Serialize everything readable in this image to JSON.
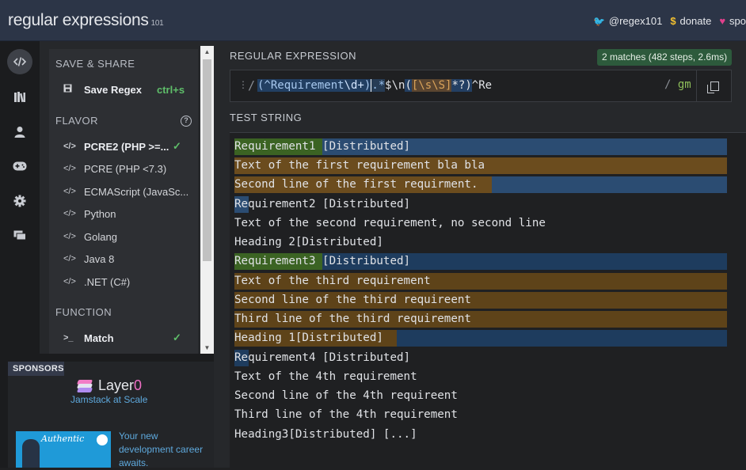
{
  "header": {
    "brand": "regular expressions",
    "brand_sup": "101",
    "twitter": "@regex101",
    "donate": "donate",
    "sponsor": "spo"
  },
  "left_nav": {
    "icons": [
      "regex-editor-icon",
      "library-icon",
      "user-icon",
      "quiz-icon",
      "settings-icon",
      "chat-icon"
    ]
  },
  "side_panel": {
    "save_share_heading": "SAVE & SHARE",
    "save_label": "Save Regex",
    "save_shortcut": "ctrl+s",
    "flavor_heading": "FLAVOR",
    "flavors": [
      {
        "label": "PCRE2 (PHP >=...",
        "selected": true
      },
      {
        "label": "PCRE (PHP <7.3)",
        "selected": false
      },
      {
        "label": "ECMAScript (JavaSc...",
        "selected": false
      },
      {
        "label": "Python",
        "selected": false
      },
      {
        "label": "Golang",
        "selected": false
      },
      {
        "label": "Java 8",
        "selected": false
      },
      {
        "label": ".NET (C#)",
        "selected": false
      }
    ],
    "function_heading": "FUNCTION",
    "function_match": "Match"
  },
  "sponsors": {
    "tag": "SPONSORS",
    "layer_name": "Layer",
    "layer_zero": "0",
    "layer_tagline": "Jamstack at Scale",
    "ad_text": "Your new development career awaits.",
    "ad_image_label": "Authentic"
  },
  "regex": {
    "label": "REGULAR EXPRESSION",
    "matches": "2 matches (482 steps, 2.6ms)",
    "delimiter": "/",
    "flags": "gm",
    "pattern": "(^Requirement\\d+).*$\\n([\\s\\S]*?)^Re"
  },
  "test_string": {
    "label": "TEST STRING",
    "lines": [
      "Requirement1 [Distributed] ",
      "Text of the first requirement bla bla",
      "Second line of the first requirment.",
      "Requirement2 [Distributed] ",
      "Text of the second requirement, no second line",
      "Heading 2[Distributed]",
      "Requirement3 [Distributed]",
      "Text of the third requirement ",
      "Second line of the third requireent ",
      "Third line of the third requirement",
      "Heading 1[Distributed]",
      "Requirement4 [Distributed]",
      "Text of the 4th requirement",
      "Second line of the 4th requireent",
      "Third line of the 4th requirement",
      "Heading3[Distributed] [...]"
    ]
  },
  "colors": {
    "match_blue": "#2b4c72",
    "group1_green": "#3b6323",
    "group2_orange": "#6b4c1e",
    "accent_green": "#5fbf6a"
  }
}
